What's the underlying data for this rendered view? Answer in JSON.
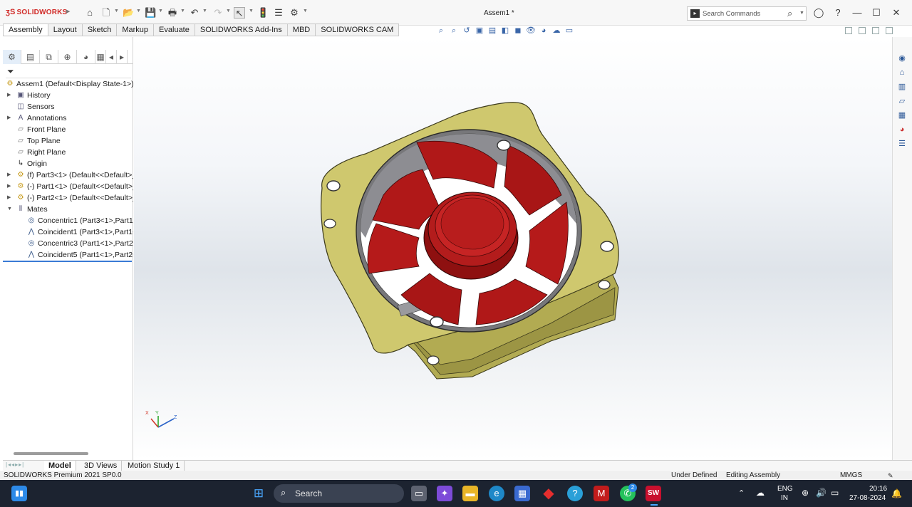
{
  "app": {
    "logo": "SOLIDWORKS",
    "document_title": "Assem1 *",
    "search_placeholder": "Search Commands"
  },
  "command_tabs": [
    "Assembly",
    "Layout",
    "Sketch",
    "Markup",
    "Evaluate",
    "SOLIDWORKS Add-Ins",
    "MBD",
    "SOLIDWORKS CAM"
  ],
  "feature_tree": {
    "root": "Assem1  (Default<Display State-1>)",
    "items": [
      {
        "label": "History",
        "icon": "history-icon"
      },
      {
        "label": "Sensors",
        "icon": "sensor-icon"
      },
      {
        "label": "Annotations",
        "icon": "annotations-icon"
      },
      {
        "label": "Front Plane",
        "icon": "plane-icon"
      },
      {
        "label": "Top Plane",
        "icon": "plane-icon"
      },
      {
        "label": "Right Plane",
        "icon": "plane-icon"
      },
      {
        "label": "Origin",
        "icon": "origin-icon"
      },
      {
        "label": "(f) Part3<1> (Default<<Default>_",
        "icon": "part-icon"
      },
      {
        "label": "(-) Part1<1> (Default<<Default>_",
        "icon": "part-icon"
      },
      {
        "label": "(-) Part2<1> (Default<<Default>_",
        "icon": "part-icon"
      },
      {
        "label": "Mates",
        "icon": "mates-icon"
      },
      {
        "label": "Concentric1 (Part3<1>,Part1<",
        "icon": "concentric-icon"
      },
      {
        "label": "Coincident1 (Part3<1>,Part1<",
        "icon": "coincident-icon"
      },
      {
        "label": "Concentric3 (Part1<1>,Part2<",
        "icon": "concentric-icon"
      },
      {
        "label": "Coincident5 (Part1<1>,Part2<",
        "icon": "coincident-icon"
      }
    ]
  },
  "bottom_tabs": [
    "Model",
    "3D Views",
    "Motion Study 1"
  ],
  "status": {
    "version": "SOLIDWORKS Premium 2021 SP0.0",
    "definition": "Under Defined",
    "mode": "Editing Assembly",
    "units": "MMGS"
  },
  "triad": {
    "x": "X",
    "y": "Y",
    "z": "Z"
  },
  "taskbar": {
    "search": "Search",
    "lang_top": "ENG",
    "lang_bottom": "IN",
    "time": "20:16",
    "date": "27-08-2024",
    "badge": "2"
  },
  "colors": {
    "fan_housing": "#cfc86e",
    "fan_blade": "#b01818",
    "accent": "#3a7bd5",
    "taskbar": "#1c2330"
  }
}
